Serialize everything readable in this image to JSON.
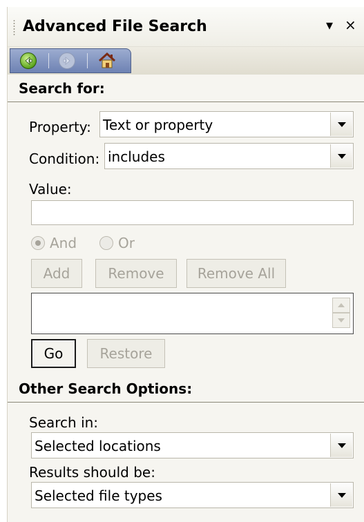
{
  "pane": {
    "title": "Advanced File Search",
    "menu_glyph": "▾",
    "close_glyph": "×"
  },
  "nav": {
    "icons": [
      "back-arrow-icon",
      "forward-arrow-icon",
      "home-icon"
    ]
  },
  "search_for": {
    "heading": "Search for:",
    "property_label": "Property:",
    "property_value": "Text or property",
    "condition_label": "Condition:",
    "condition_value": "includes",
    "value_label": "Value:",
    "value_text": "",
    "and_label": "And",
    "or_label": "Or",
    "and_selected": true,
    "add_label": "Add",
    "remove_label": "Remove",
    "remove_all_label": "Remove All",
    "go_label": "Go",
    "restore_label": "Restore"
  },
  "other_options": {
    "heading": "Other Search Options:",
    "search_in_label": "Search in:",
    "search_in_value": "Selected locations",
    "results_label": "Results should be:",
    "results_value": "Selected file types"
  },
  "colors": {
    "pane_bg": "#f6f5f0",
    "nav_blue": "#6e82b3",
    "disabled_text": "#a6a39a"
  }
}
